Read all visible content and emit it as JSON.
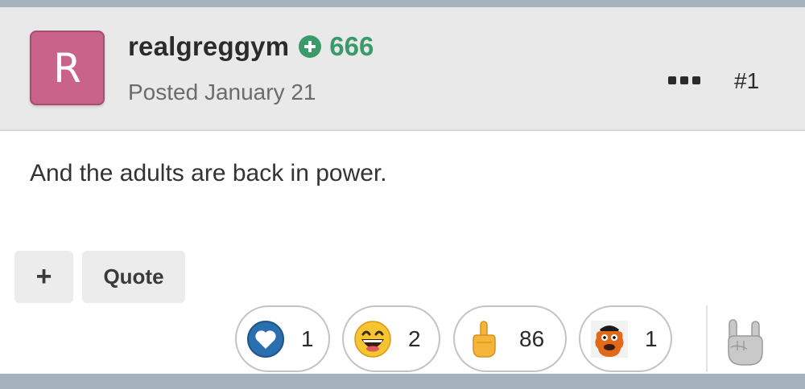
{
  "post": {
    "avatar_letter": "R",
    "username": "realgreggym",
    "reputation": "666",
    "posted": "Posted January 21",
    "post_number": "#1",
    "content": "And the adults are back in power.",
    "colors": {
      "avatar_bg": "#c9638a",
      "reputation_green": "#3a9a6a",
      "header_bg": "#e9e9e9",
      "frame_bg": "#a4b3bd"
    }
  },
  "actions": {
    "plus_label": "+",
    "quote_label": "Quote"
  },
  "reactions": [
    {
      "icon": "heart-like-icon",
      "count": "1"
    },
    {
      "icon": "grinning-face-icon",
      "count": "2"
    },
    {
      "icon": "middle-finger-icon",
      "count": "86"
    },
    {
      "icon": "gritty-mascot-icon",
      "count": "1"
    }
  ],
  "react_trigger_icon": "rock-on-hand-icon",
  "more_icon": "ellipsis-icon"
}
